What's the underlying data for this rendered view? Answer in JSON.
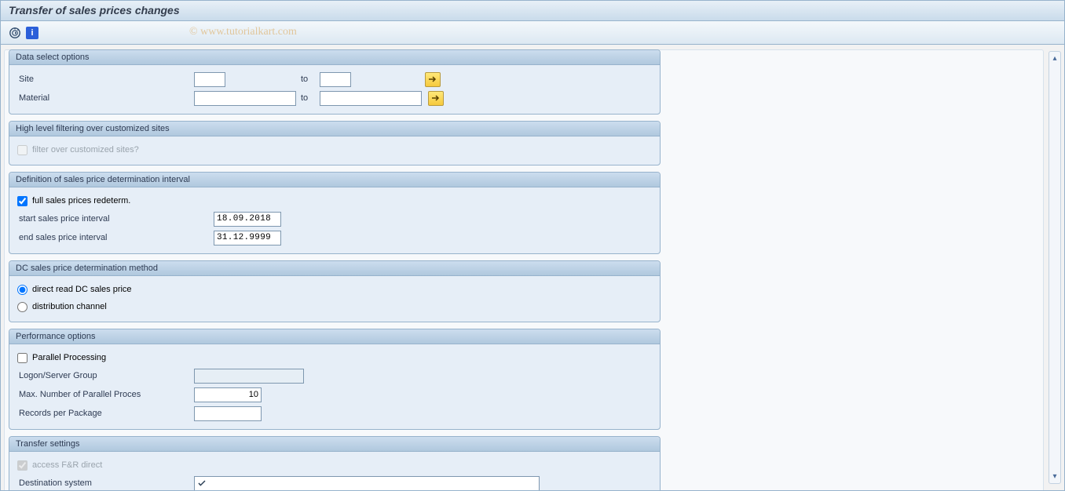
{
  "title": "Transfer of sales prices changes",
  "watermark": "© www.tutorialkart.com",
  "toolbar": {
    "execute_name": "Execute",
    "info_name": "Information"
  },
  "groups": {
    "dataSelect": {
      "header": "Data select options",
      "site_label": "Site",
      "material_label": "Material",
      "to_label": "to",
      "site_from": "",
      "site_to": "",
      "material_from": "",
      "material_to": ""
    },
    "highLevel": {
      "header": "High level filtering over customized sites",
      "filter_label": "filter over customized sites?",
      "filter_checked": false,
      "filter_enabled": false
    },
    "interval": {
      "header": "Definition of sales price determination interval",
      "full_label": "full sales prices redeterm.",
      "full_checked": true,
      "start_label": "start sales price interval",
      "start_value": "18.09.2018",
      "end_label": "end sales price interval",
      "end_value": "31.12.9999"
    },
    "dcMethod": {
      "header": "DC sales price determination method",
      "opt1_label": "direct read DC sales price",
      "opt2_label": "distribution channel",
      "selected": "opt1"
    },
    "perf": {
      "header": "Performance options",
      "parallel_label": "Parallel Processing",
      "parallel_checked": false,
      "logon_label": "Logon/Server Group",
      "logon_value": "",
      "max_label": "Max. Number of Parallel Proces",
      "max_value": "10",
      "records_label": "Records per Package",
      "records_value": ""
    },
    "transfer": {
      "header": "Transfer settings",
      "access_label": "access F&R direct",
      "access_checked": true,
      "access_enabled": false,
      "dest_label": "Destination system",
      "dest_value": ""
    }
  }
}
